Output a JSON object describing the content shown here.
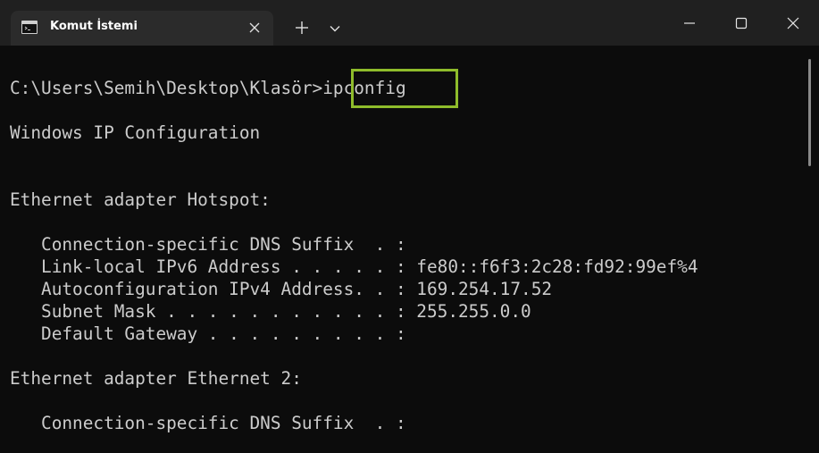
{
  "tab": {
    "title": "Komut İstemi",
    "icon": "command-prompt-icon"
  },
  "titlebar_controls": {
    "new_tab_icon": "plus-icon",
    "dropdown_icon": "chevron-down-icon",
    "minimize_icon": "minimize-icon",
    "maximize_icon": "maximize-icon",
    "close_icon": "close-icon"
  },
  "console": {
    "prompt": "C:\\Users\\Semih\\Desktop\\Klasör>",
    "command": "ipconfig",
    "lines": [
      "Windows IP Configuration",
      "Ethernet adapter Hotspot:",
      "   Connection-specific DNS Suffix  . :",
      "   Link-local IPv6 Address . . . . . : fe80::f6f3:2c28:fd92:99ef%4",
      "   Autoconfiguration IPv4 Address. . : 169.254.17.52",
      "   Subnet Mask . . . . . . . . . . . : 255.255.0.0",
      "   Default Gateway . . . . . . . . . :",
      "Ethernet adapter Ethernet 2:",
      "   Connection-specific DNS Suffix  . :"
    ]
  },
  "colors": {
    "background": "#0c0c0c",
    "titlebar": "#202020",
    "tab": "#2b2b2b",
    "text": "#cccccc",
    "highlight": "#8fbc2b"
  }
}
